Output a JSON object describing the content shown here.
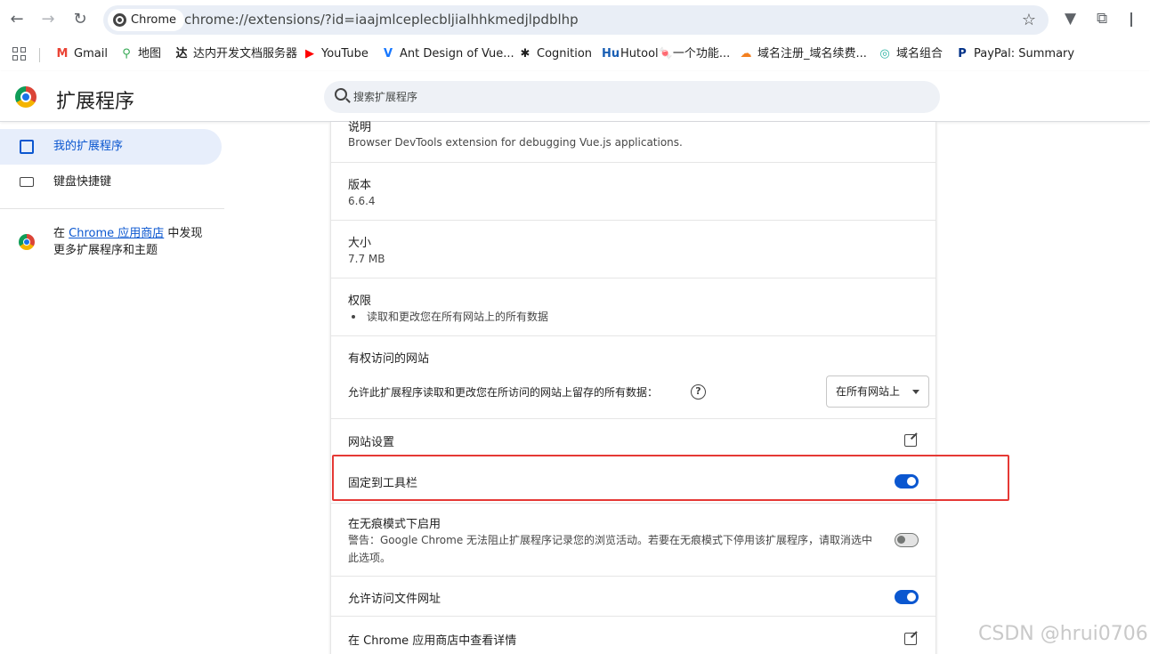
{
  "browser": {
    "chip_label": "Chrome",
    "url": "chrome://extensions/?id=iaajmlceplecbljialhhkmedjlpdblhp"
  },
  "bookmarks": [
    {
      "label": "Gmail",
      "icon": "M",
      "color": "#ea4335"
    },
    {
      "label": "地图",
      "icon": "⚲",
      "color": "#34a853"
    },
    {
      "label": "达内开发文档服务器",
      "icon": "达",
      "color": "#1f1f1f"
    },
    {
      "label": "YouTube",
      "icon": "▶",
      "color": "#ff0000"
    },
    {
      "label": "Ant Design of Vue...",
      "icon": "V",
      "color": "#1677ff"
    },
    {
      "label": "Cognition",
      "icon": "✱",
      "color": "#1f1f1f"
    },
    {
      "label": "Hutool🍬一个功能...",
      "icon": "Hu",
      "color": "#1a5fb4"
    },
    {
      "label": "域名注册_域名续费...",
      "icon": "☁",
      "color": "#f38020"
    },
    {
      "label": "域名组合",
      "icon": "◎",
      "color": "#2bb3a3"
    },
    {
      "label": "PayPal: Summary",
      "icon": "P",
      "color": "#003087"
    }
  ],
  "header": {
    "title": "扩展程序",
    "search_placeholder": "搜索扩展程序"
  },
  "sidebar": {
    "items": [
      {
        "label": "我的扩展程序",
        "active": true
      },
      {
        "label": "键盘快捷键",
        "active": false
      }
    ],
    "store_prefix": "在 ",
    "store_link": "Chrome 应用商店",
    "store_suffix": " 中发现更多扩展程序和主题"
  },
  "details": {
    "description_label": "说明",
    "description": "Browser DevTools extension for debugging Vue.js applications.",
    "version_label": "版本",
    "version": "6.6.4",
    "size_label": "大小",
    "size": "7.7 MB",
    "permissions_label": "权限",
    "permissions": [
      "读取和更改您在所有网站上的所有数据"
    ],
    "site_access_label": "有权访问的网站",
    "site_access_desc": "允许此扩展程序读取和更改您在所访问的网站上留存的所有数据：",
    "site_access_value": "在所有网站上",
    "site_settings_label": "网站设置",
    "pin_label": "固定到工具栏",
    "pin_on": true,
    "incognito_label": "在无痕模式下启用",
    "incognito_warning": "警告：Google Chrome 无法阻止扩展程序记录您的浏览活动。若要在无痕模式下停用该扩展程序，请取消选中此选项。",
    "incognito_on": false,
    "file_urls_label": "允许访问文件网址",
    "file_urls_on": true,
    "store_view_label": "在 Chrome 应用商店中查看详情"
  },
  "watermark": "CSDN @hrui0706"
}
